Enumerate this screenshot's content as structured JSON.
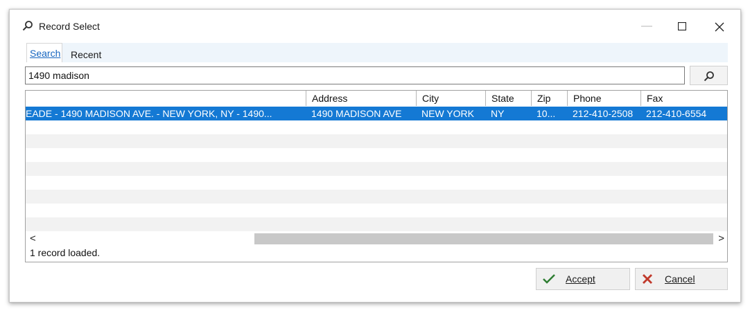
{
  "window": {
    "title": "Record Select"
  },
  "tabs": [
    {
      "label": "Search"
    },
    {
      "label": "Recent"
    }
  ],
  "search": {
    "value": "1490 madison"
  },
  "grid": {
    "columns": [
      "",
      "Address",
      "City",
      "State",
      "Zip",
      "Phone",
      "Fax"
    ],
    "rows": [
      [
        "EADE - 1490 MADISON AVE. - NEW YORK, NY - 1490...",
        "1490 MADISON AVE",
        "NEW YORK",
        "NY",
        "10...",
        "212-410-2508",
        "212-410-6554"
      ]
    ]
  },
  "scroll": {
    "left": "<",
    "right": ">"
  },
  "status": "1 record loaded.",
  "buttons": {
    "accept": "Accept",
    "cancel": "Cancel"
  },
  "colors": {
    "selection": "#1479d4",
    "tab_active_text": "#1565c0",
    "accept_check": "#2e7d32",
    "cancel_x": "#c0392b"
  },
  "icons": {
    "title": "search-icon",
    "search_button": "search-icon",
    "accept": "checkmark-icon",
    "cancel": "close-icon"
  }
}
